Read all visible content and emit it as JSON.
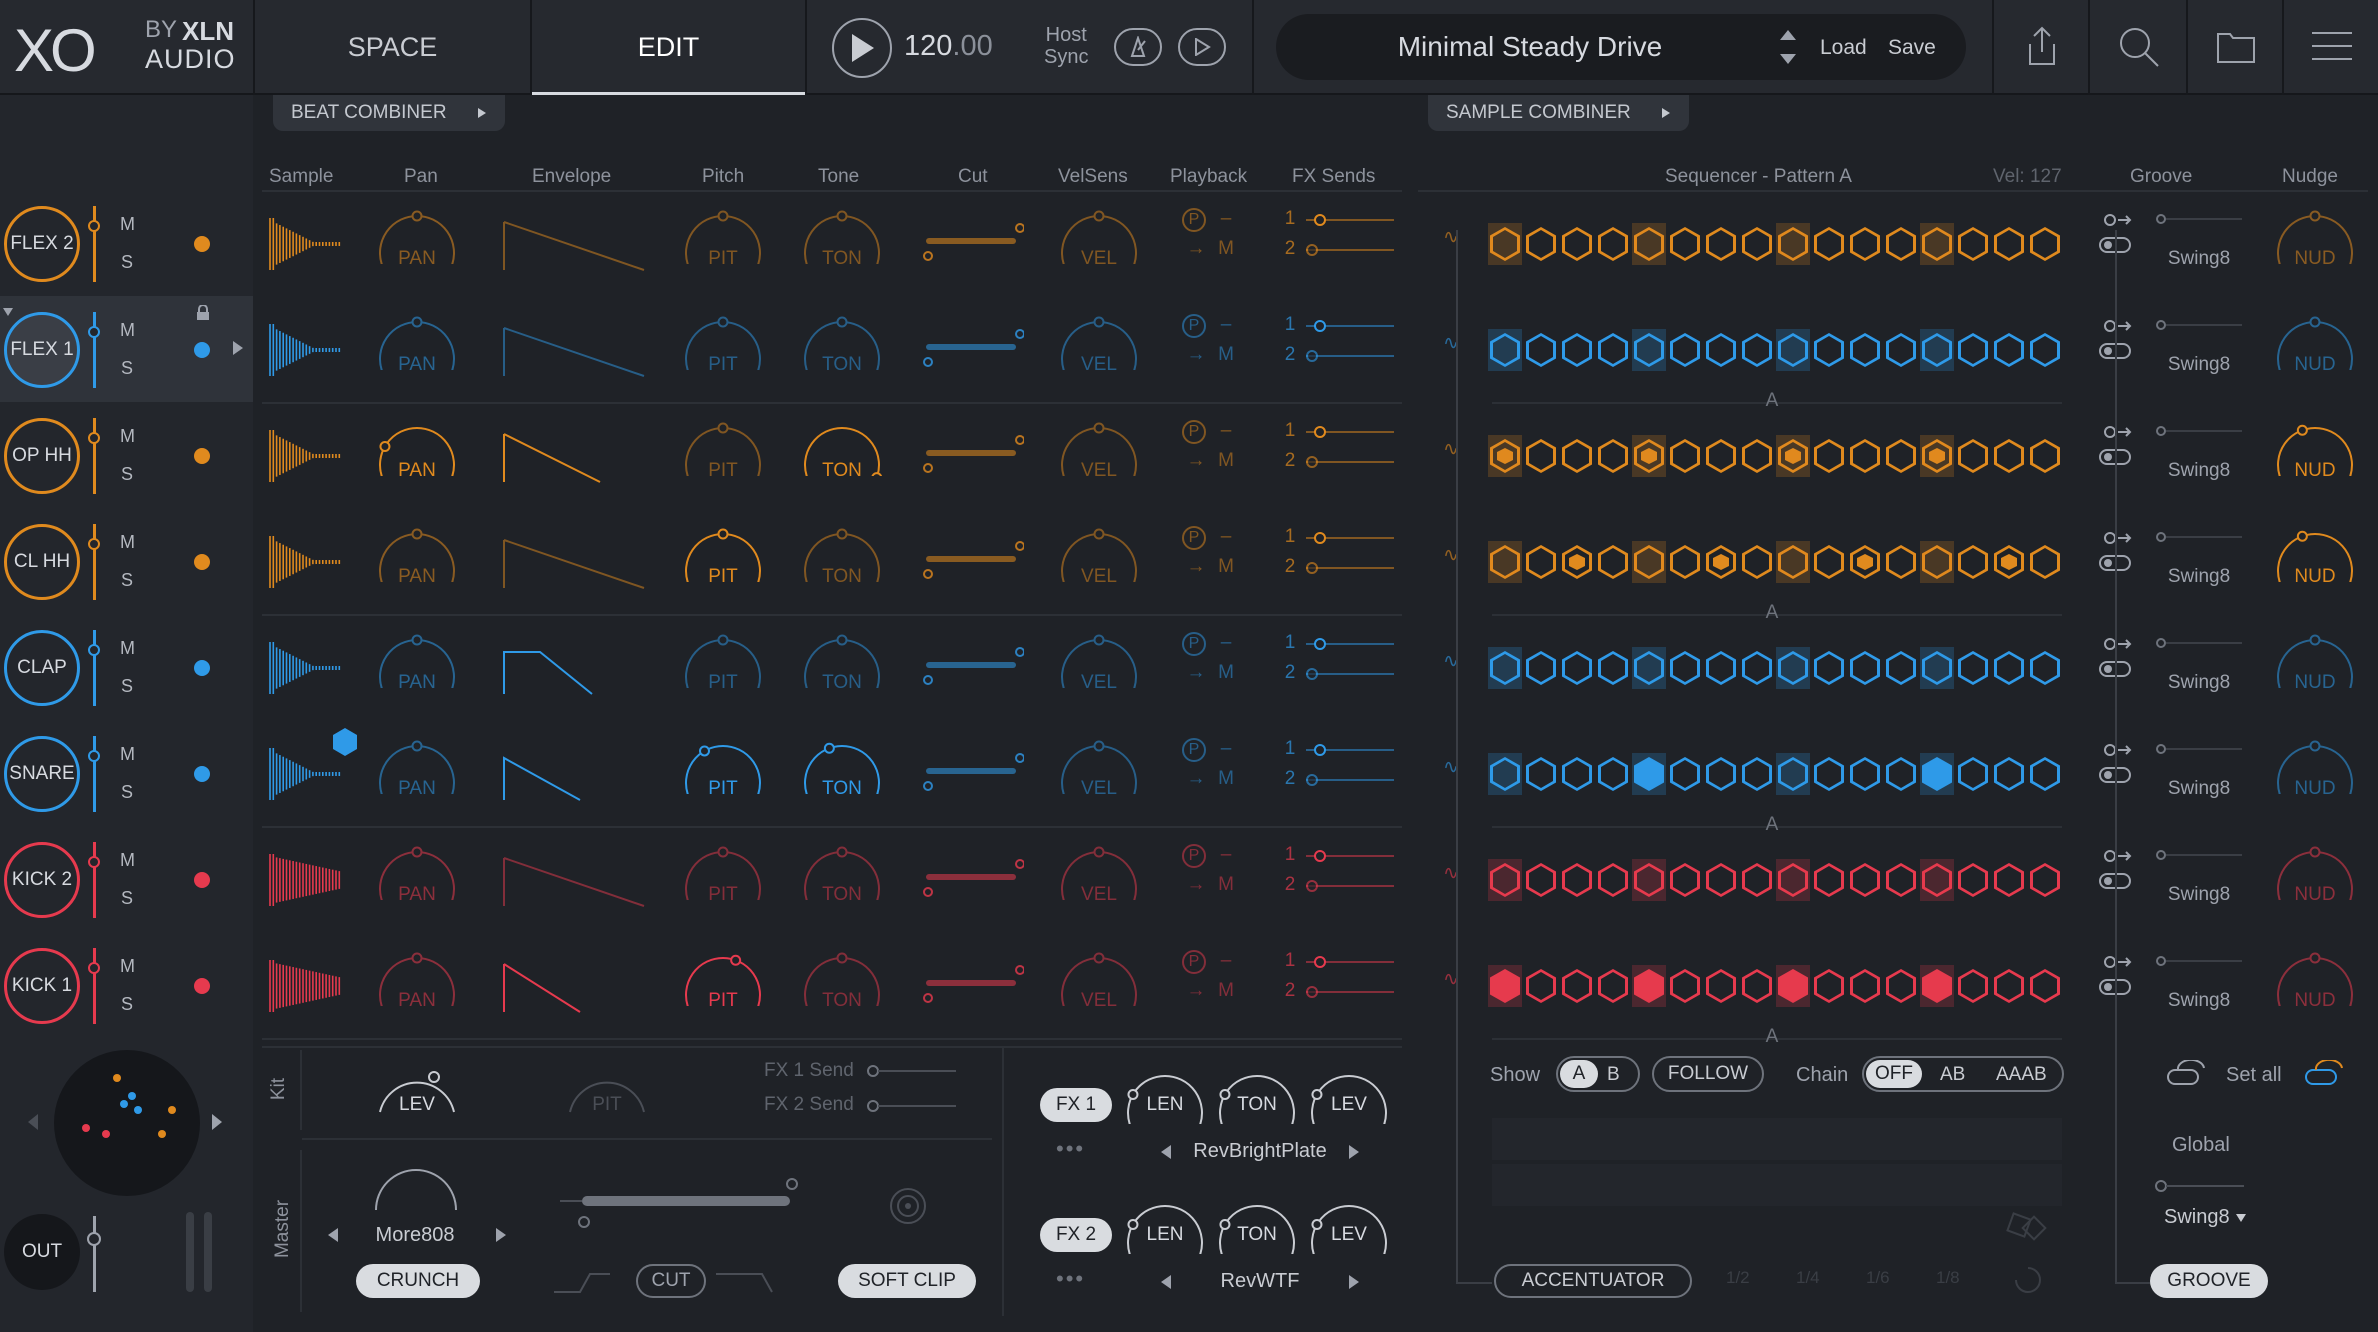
{
  "topbar": {
    "logo": "XO",
    "by": "BY",
    "brand1": "XLN",
    "brand2": "AUDIO",
    "tab_space": "SPACE",
    "tab_edit": "EDIT",
    "tempo": "120",
    "tempo_dec": ".00",
    "host1": "Host",
    "host2": "Sync",
    "preset": "Minimal Steady Drive",
    "load": "Load",
    "save": "Save"
  },
  "combiners": {
    "beat": "BEAT COMBINER",
    "sample": "SAMPLE COMBINER"
  },
  "columns": {
    "sample": "Sample",
    "pan": "Pan",
    "envelope": "Envelope",
    "pitch": "Pitch",
    "tone": "Tone",
    "cut": "Cut",
    "velsens": "VelSens",
    "playback": "Playback",
    "fxsends": "FX Sends",
    "sequencer": "Sequencer - Pattern A",
    "vel": "Vel: 127",
    "groove": "Groove",
    "nudge": "Nudge"
  },
  "knob_labels": {
    "pan": "PAN",
    "pit": "PIT",
    "ton": "TON",
    "vel": "VEL",
    "nud": "NUD",
    "p": "P",
    "dash": "–",
    "arrow": "→",
    "m": "M",
    "s": "S",
    "one": "1",
    "two": "2",
    "swing": "Swing8",
    "pattern": "A"
  },
  "colors": {
    "orange": "#e08a1e",
    "blue": "#2f9ae8",
    "red": "#e63a4e"
  },
  "tracks": [
    {
      "name": "FLEX 2",
      "color": "orange",
      "steps": [
        1,
        0,
        0,
        0,
        1,
        0,
        0,
        0,
        1,
        0,
        0,
        0,
        1,
        0,
        0,
        0
      ],
      "filled": []
    },
    {
      "name": "FLEX 1",
      "color": "blue",
      "steps": [
        1,
        0,
        0,
        0,
        1,
        0,
        0,
        0,
        1,
        0,
        0,
        0,
        1,
        0,
        0,
        0
      ],
      "filled": []
    },
    {
      "name": "OP HH",
      "color": "orange",
      "steps": [
        1,
        0,
        0,
        0,
        1,
        0,
        0,
        0,
        1,
        0,
        0,
        0,
        1,
        0,
        0,
        0
      ],
      "filled": [
        0,
        4,
        8,
        12
      ]
    },
    {
      "name": "CL HH",
      "color": "orange",
      "steps": [
        1,
        0,
        0,
        0,
        1,
        0,
        0,
        0,
        1,
        0,
        0,
        0,
        1,
        0,
        0,
        0
      ],
      "filled": [
        2,
        6,
        10,
        14
      ]
    },
    {
      "name": "CLAP",
      "color": "blue",
      "steps": [
        1,
        0,
        0,
        0,
        1,
        0,
        0,
        0,
        1,
        0,
        0,
        0,
        1,
        0,
        0,
        0
      ],
      "filled": []
    },
    {
      "name": "SNARE",
      "color": "blue",
      "steps": [
        1,
        0,
        0,
        0,
        1,
        0,
        0,
        0,
        1,
        0,
        0,
        0,
        1,
        0,
        0,
        0
      ],
      "filled": [
        4,
        12
      ]
    },
    {
      "name": "KICK 2",
      "color": "red",
      "steps": [
        1,
        0,
        0,
        0,
        1,
        0,
        0,
        0,
        1,
        0,
        0,
        0,
        1,
        0,
        0,
        0
      ],
      "filled": []
    },
    {
      "name": "KICK 1",
      "color": "red",
      "steps": [
        1,
        0,
        0,
        0,
        1,
        0,
        0,
        0,
        1,
        0,
        0,
        0,
        1,
        0,
        0,
        0
      ],
      "filled": [
        0,
        4,
        8,
        12
      ]
    }
  ],
  "bottom": {
    "kit": "Kit",
    "master": "Master",
    "lev": "LEV",
    "pit": "PIT",
    "fx1send": "FX 1 Send",
    "fx2send": "FX 2 Send",
    "more808": "More808",
    "crunch": "CRUNCH",
    "cut": "CUT",
    "softclip": "SOFT CLIP",
    "fx1": "FX 1",
    "fx2": "FX 2",
    "len": "LEN",
    "ton": "TON",
    "fxlev": "LEV",
    "rev1": "RevBrightPlate",
    "rev2": "RevWTF",
    "show": "Show",
    "a": "A",
    "b": "B",
    "follow": "FOLLOW",
    "chain": "Chain",
    "off": "OFF",
    "ab": "AB",
    "aaab": "AAAB",
    "accentuator": "ACCENTUATOR",
    "setall": "Set all",
    "global": "Global",
    "globalswing": "Swing8",
    "groove": "GROOVE",
    "r12": "1/2",
    "r14": "1/4",
    "r16": "1/6",
    "r18": "1/8",
    "out": "OUT"
  }
}
